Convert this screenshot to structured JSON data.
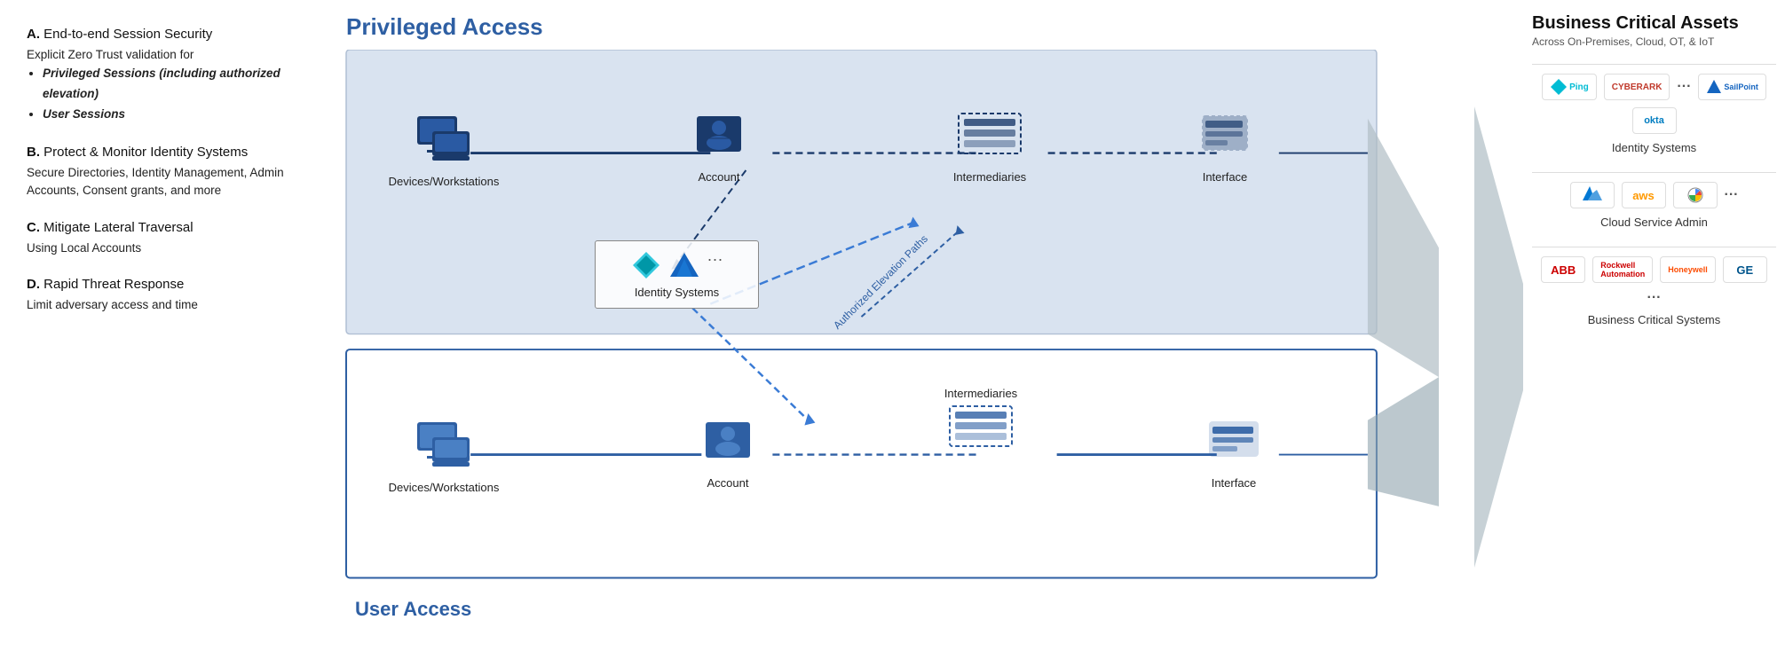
{
  "left_panel": {
    "title": "Privileged Access",
    "sections": [
      {
        "id": "A",
        "title": "End-to-end Session Security",
        "content": "Explicit Zero Trust validation for",
        "bullets": [
          "Privileged Sessions (including authorized elevation)",
          "User Sessions"
        ]
      },
      {
        "id": "B",
        "title": "Protect & Monitor Identity Systems",
        "content": "Secure Directories, Identity Management, Admin Accounts, Consent grants, and more"
      },
      {
        "id": "C",
        "title": "Mitigate Lateral Traversal",
        "content": "Using Local Accounts"
      },
      {
        "id": "D",
        "title": "Rapid Threat Response",
        "content": "Limit adversary access and time"
      }
    ]
  },
  "diagram": {
    "main_title": "Privileged Access",
    "user_access_label": "User Access",
    "priv_row": {
      "nodes": [
        "Devices/Workstations",
        "Account",
        "Intermediaries",
        "Interface"
      ]
    },
    "user_row": {
      "nodes": [
        "Devices/Workstations",
        "Account",
        "Intermediaries",
        "Interface"
      ]
    },
    "identity_systems_label": "Identity Systems",
    "authorized_elevation_label": "Authorized Elevation Paths"
  },
  "bca": {
    "title": "Business Critical Assets",
    "subtitle": "Across On-Premises, Cloud, OT, & IoT",
    "sections": [
      {
        "label": "Identity Systems",
        "logos": [
          "Ping",
          "CyberArk",
          "SailPoint",
          "okta",
          "..."
        ]
      },
      {
        "label": "Cloud Service Admin",
        "logos": [
          "Azure",
          "aws",
          "Google",
          "..."
        ]
      },
      {
        "label": "Business Critical Systems",
        "logos": [
          "ABB",
          "Rockwell Automation",
          "Honeywell",
          "GE",
          "..."
        ]
      }
    ]
  }
}
